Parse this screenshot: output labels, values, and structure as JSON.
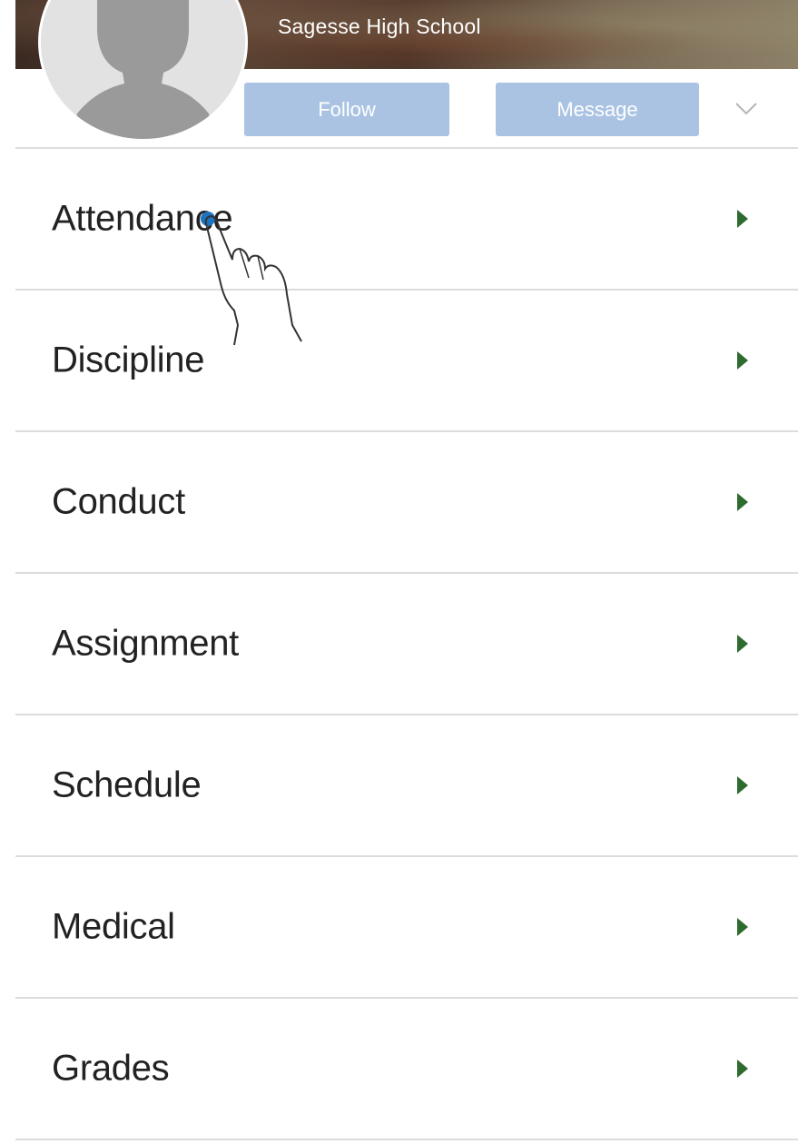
{
  "header": {
    "school_name": "Sagesse High School",
    "follow_label": "Follow",
    "message_label": "Message",
    "more_icon": "chevron-down-icon"
  },
  "colors": {
    "button_bg": "#aac3e2",
    "arrow": "#2e6b2e",
    "divider": "#dcdcdc",
    "tap_dot": "#1e73be"
  },
  "menu": {
    "items": [
      {
        "label": "Attendance",
        "icon": "play-arrow-icon"
      },
      {
        "label": "Discipline",
        "icon": "play-arrow-icon"
      },
      {
        "label": "Conduct",
        "icon": "play-arrow-icon"
      },
      {
        "label": "Assignment",
        "icon": "play-arrow-icon"
      },
      {
        "label": "Schedule",
        "icon": "play-arrow-icon"
      },
      {
        "label": "Medical",
        "icon": "play-arrow-icon"
      },
      {
        "label": "Grades",
        "icon": "play-arrow-icon"
      }
    ]
  }
}
